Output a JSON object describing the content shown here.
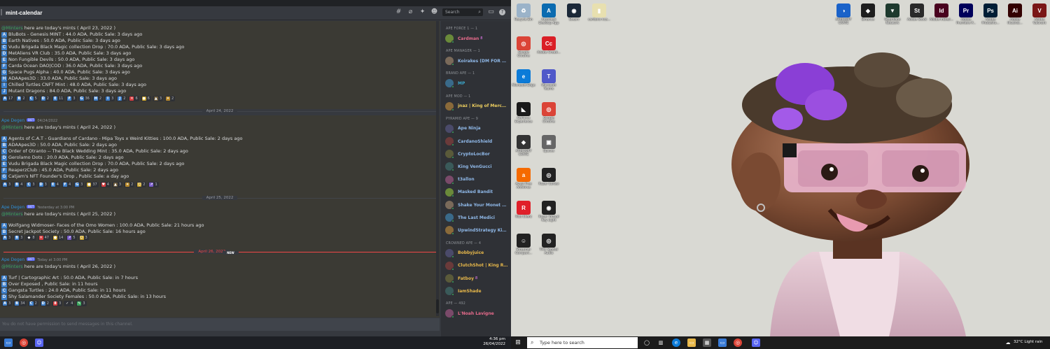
{
  "channel": {
    "title": "mint-calendar",
    "search_placeholder": "Search"
  },
  "messages": [
    {
      "greeting_mention": "@Minters",
      "greeting_text": " here are today's mints ( April 23, 2022 )",
      "items": [
        {
          "letter": "A",
          "text": "BluBots - Genesis MINT : 44.0 ADA, Public Sale: 3 days ago"
        },
        {
          "letter": "B",
          "text": "Earth Natives : 50.0 ADA, Public Sale: 3 days ago"
        },
        {
          "letter": "C",
          "text": "Vudu Brigada Black Magic collection Drop : 70.0 ADA, Public Sale: 3 days ago"
        },
        {
          "letter": "D",
          "text": "MetAliens VR Club : 35.0 ADA, Public Sale: 3 days ago"
        },
        {
          "letter": "E",
          "text": "Non Fungible Devils : 50.0 ADA, Public Sale: 3 days ago"
        },
        {
          "letter": "F",
          "text": "Carda Ocean DAO|COD : 36.0 ADA, Public Sale: 3 days ago"
        },
        {
          "letter": "G",
          "text": "Space Pugs Alpha : 40.0 ADA, Public Sale: 3 days ago"
        },
        {
          "letter": "H",
          "text": "ADAApes3D : 33.0 ADA, Public Sale: 3 days ago"
        },
        {
          "letter": "I",
          "text": "Chilled Turtles CNFT Mint : 48.0 ADA, Public Sale: 3 days ago"
        },
        {
          "letter": "J",
          "text": "Mutant Dragons : 84.0 ADA, Public Sale: 3 days ago"
        }
      ],
      "reactions": [
        {
          "icon": "A",
          "color": "#3c7ec9",
          "count": "17"
        },
        {
          "icon": "B",
          "color": "#3c7ec9",
          "count": "2"
        },
        {
          "icon": "C",
          "color": "#3c7ec9",
          "count": "5"
        },
        {
          "icon": "D",
          "color": "#3c7ec9",
          "count": "2"
        },
        {
          "icon": "E",
          "color": "#3c7ec9",
          "count": "11"
        },
        {
          "icon": "F",
          "color": "#3c7ec9",
          "count": "3"
        },
        {
          "icon": "G",
          "color": "#3c7ec9",
          "count": "36"
        },
        {
          "icon": "H",
          "color": "#3c7ec9",
          "count": "2"
        },
        {
          "icon": "I",
          "color": "#3c7ec9",
          "count": "3"
        },
        {
          "icon": "J",
          "color": "#3c7ec9",
          "count": "2"
        },
        {
          "icon": "✕",
          "color": "#d83c3e",
          "count": "6"
        },
        {
          "icon": "●",
          "color": "#c9a227",
          "count": "6"
        },
        {
          "icon": "▲",
          "color": "#6b5a3a",
          "count": "3"
        },
        {
          "icon": "✦",
          "color": "#b8892a",
          "count": "2"
        }
      ]
    },
    {
      "date_divider": "April 24, 2022",
      "author": "Ape Degen",
      "bot_tag": "BOT",
      "timestamp": "04/24/2022",
      "greeting_mention": "@Minters",
      "greeting_text": " here are today's mints ( April 24, 2022 )",
      "items": [
        {
          "letter": "A",
          "text": "Agents of C.A.T - Guardians of Cardano - Mipa Toys x Weird Kitties : 100.0 ADA, Public Sale: 2 days ago"
        },
        {
          "letter": "B",
          "text": "ADAApes3D : 50.0 ADA, Public Sale: 2 days ago"
        },
        {
          "letter": "C",
          "text": "Order of Otranto -- The Black Wedding Mint : 35.0 ADA, Public Sale: 2 days ago"
        },
        {
          "letter": "D",
          "text": "Gerolamo Dots : 20.0 ADA, Public Sale: 2 days ago"
        },
        {
          "letter": "E",
          "text": "Vudu Brigada Black Magic collection Drop : 70.0 ADA, Public Sale: 2 days ago"
        },
        {
          "letter": "F",
          "text": "ReaperzClub : 45.0 ADA, Public Sale: 2 days ago"
        },
        {
          "letter": "G",
          "text": "Catjam's NFT Founder's Drop , Public Sale: a day ago"
        }
      ],
      "reactions": [
        {
          "icon": "A",
          "color": "#3c7ec9",
          "count": "3"
        },
        {
          "icon": "B",
          "color": "#3c7ec9",
          "count": "4"
        },
        {
          "icon": "C",
          "color": "#3c7ec9",
          "count": "3"
        },
        {
          "icon": "D",
          "color": "#3c7ec9",
          "count": "3"
        },
        {
          "icon": "E",
          "color": "#3c7ec9",
          "count": "4"
        },
        {
          "icon": "F",
          "color": "#3c7ec9",
          "count": "4"
        },
        {
          "icon": "G",
          "color": "#3c7ec9",
          "count": "3"
        },
        {
          "icon": "●",
          "color": "#c9a227",
          "count": "37"
        },
        {
          "icon": "♥",
          "color": "#d83c3e",
          "count": "4"
        },
        {
          "icon": "▲",
          "color": "#6b5a3a",
          "count": "3"
        },
        {
          "icon": "✦",
          "color": "#b8892a",
          "count": "2"
        },
        {
          "icon": "☺",
          "color": "#c9a227",
          "count": "2"
        },
        {
          "icon": "↗",
          "color": "#7a5cc9",
          "count": "1"
        }
      ]
    },
    {
      "date_divider": "April 25, 2022",
      "author": "Ape Degen",
      "bot_tag": "BOT",
      "timestamp": "Yesterday at 3:00 PM",
      "greeting_mention": "@Minters",
      "greeting_text": " here are today's mints ( April 25, 2022 )",
      "items": [
        {
          "letter": "A",
          "text": "Wolfgang Widmoser- Faces of the Omo Women : 100.0 ADA, Public Sale: 21 hours ago"
        },
        {
          "letter": "B",
          "text": "Secret Jackpot Society : 50.0 ADA, Public Sale: 16 hours ago"
        }
      ],
      "reactions": [
        {
          "icon": "A",
          "color": "#3c7ec9",
          "count": "3"
        },
        {
          "icon": "B",
          "color": "#3c7ec9",
          "count": "3"
        },
        {
          "icon": "◆",
          "color": "#2f3136",
          "count": "8"
        },
        {
          "icon": "✕",
          "color": "#d83c3e",
          "count": "47"
        },
        {
          "icon": "●",
          "color": "#c9a227",
          "count": "14"
        },
        {
          "icon": "↗",
          "color": "#7a5cc9",
          "count": "5"
        },
        {
          "icon": "☺",
          "color": "#c9a227",
          "count": "3"
        }
      ]
    },
    {
      "date_divider": "April 26, 2022",
      "new_badge": "NEW",
      "author": "Ape Degen",
      "bot_tag": "BOT",
      "timestamp": "Today at 3:00 PM",
      "greeting_mention": "@Minters",
      "greeting_text": " here are today's mints ( April 26, 2022 )",
      "items": [
        {
          "letter": "A",
          "text": "Turf | Cartographic Art : 50.0 ADA, Public Sale: in 7 hours"
        },
        {
          "letter": "B",
          "text": "Over Exposed , Public Sale: in 11 hours"
        },
        {
          "letter": "C",
          "text": "Gangsta Turtles : 24.0 ADA, Public Sale: in 11 hours"
        },
        {
          "letter": "D",
          "text": "Shy Salamander Society Females : 50.0 ADA, Public Sale: in 13 hours"
        }
      ],
      "reactions": [
        {
          "icon": "A",
          "color": "#3c7ec9",
          "count": "3"
        },
        {
          "icon": "B",
          "color": "#3c7ec9",
          "count": "34"
        },
        {
          "icon": "C",
          "color": "#3c7ec9",
          "count": "2"
        },
        {
          "icon": "D",
          "color": "#3c7ec9",
          "count": "2"
        },
        {
          "icon": "8",
          "color": "#d83c3e",
          "count": "3"
        },
        {
          "icon": "✓",
          "color": "#2f3136",
          "count": "4"
        },
        {
          "icon": "✎",
          "color": "#3ba55d",
          "count": "3"
        }
      ]
    }
  ],
  "chat_input_placeholder": "You do not have permission to send messages in this channel.",
  "members": [
    {
      "role": "APE FORCE 1 — 1",
      "users": [
        {
          "name": "Cardman",
          "color": "#e86b8c",
          "badge": "8"
        }
      ]
    },
    {
      "role": "APE MANAGER — 1",
      "users": [
        {
          "name": "Koirakes (DM FOR CO...",
          "color": "#8fb8e8"
        }
      ]
    },
    {
      "role": "BRAND APE — 1",
      "users": [
        {
          "name": "MP",
          "color": "#3ba5c9"
        }
      ]
    },
    {
      "role": "APE MOD — 1",
      "users": [
        {
          "name": "jnaz | King of Merchants",
          "color": "#f0d060"
        }
      ]
    },
    {
      "role": "PYRAMID APE — 9",
      "users": [
        {
          "name": "Ape Ninja",
          "color": "#8fb8e8"
        },
        {
          "name": "CardanoShield",
          "color": "#8fb8e8"
        },
        {
          "name": "CryptoLocBor",
          "color": "#8fb8e8"
        },
        {
          "name": "King VenGucci",
          "color": "#8fb8e8"
        },
        {
          "name": "t3allon",
          "color": "#8fb8e8"
        },
        {
          "name": "Masked Bandit",
          "color": "#8fb8e8"
        },
        {
          "name": "Shake Your Monet Ma...",
          "color": "#8fb8e8"
        },
        {
          "name": "The Last Medici",
          "color": "#8fb8e8"
        },
        {
          "name": "UpwindStrategy King ...",
          "color": "#8fb8e8"
        }
      ]
    },
    {
      "role": "CROWNED APE — 4",
      "users": [
        {
          "name": "Bobbyjuice",
          "color": "#e8b84a"
        },
        {
          "name": "ClutchShot | King Rich",
          "color": "#e8b84a"
        },
        {
          "name": "Fatboy",
          "color": "#e8b84a",
          "badge": "8"
        },
        {
          "name": "IamShade",
          "color": "#e8b84a"
        }
      ]
    },
    {
      "role": "APE — 492",
      "users": [
        {
          "name": "L'Noah Lavigne",
          "color": "#e86b8c"
        }
      ]
    }
  ],
  "desktop_icons": [
    {
      "label": "Recycle Bin",
      "color": "#9bb3c9",
      "glyph": "♻"
    },
    {
      "label": "Autodesk Desktop App",
      "color": "#0b6bb0",
      "glyph": "A"
    },
    {
      "label": "Steam",
      "color": "#1b2838",
      "glyph": "◉"
    },
    {
      "label": "cardano nca...",
      "color": "#e8e0b0",
      "glyph": "▮"
    },
    {
      "label": "Google Chrome",
      "color": "#db4437",
      "glyph": "◎"
    },
    {
      "label": "Adobe Creati...",
      "color": "#da1f26",
      "glyph": "Cc"
    },
    {
      "label": "Microsoft Edge",
      "color": "#0c7bd8",
      "glyph": "e"
    },
    {
      "label": "Microsoft Teams",
      "color": "#5059c9",
      "glyph": "T"
    },
    {
      "label": "GeForce Experience",
      "color": "#1a1a1a",
      "glyph": "◣"
    },
    {
      "label": "Google Chrome",
      "color": "#db4437",
      "glyph": "◎"
    },
    {
      "label": "ARMOURY CRATE",
      "color": "#333333",
      "glyph": "◆"
    },
    {
      "label": "Spaces",
      "color": "#666666",
      "glyph": "▣"
    },
    {
      "label": "Avast Free Antivirus",
      "color": "#f56a00",
      "glyph": "a"
    },
    {
      "label": "Razer Cortex",
      "color": "#222222",
      "glyph": "◎"
    },
    {
      "label": "Riot Client",
      "color": "#e0202a",
      "glyph": "R"
    },
    {
      "label": "Razer Virtual Key Light",
      "color": "#222222",
      "glyph": "◉"
    },
    {
      "label": "Streamer Compani...",
      "color": "#222222",
      "glyph": "☺"
    },
    {
      "label": "THX Spatial Audio",
      "color": "#222222",
      "glyph": "◎"
    }
  ],
  "desktop_top_right_icons": [
    {
      "label": "ARMOURY CRATE",
      "color": "#1a62c9",
      "glyph": "◑"
    },
    {
      "label": "Binance",
      "color": "#1e1e1e",
      "glyph": "◆"
    },
    {
      "label": "Guardians Network",
      "color": "#1e3a2e",
      "glyph": "▼"
    },
    {
      "label": "Adobe Stock",
      "color": "#2a2a2a",
      "glyph": "St"
    },
    {
      "label": "Adobe InDesi...",
      "color": "#49021f",
      "glyph": "Id"
    },
    {
      "label": "Adobe Premiere P...",
      "color": "#00005b",
      "glyph": "Pr"
    },
    {
      "label": "Adobe Photosho...",
      "color": "#001e36",
      "glyph": "Ps"
    },
    {
      "label": "Adobe Illustrat...",
      "color": "#330000",
      "glyph": "Ai"
    },
    {
      "label": "Adobe Valorant",
      "color": "#7a1616",
      "glyph": "V"
    }
  ],
  "taskbar_left": {
    "time": "4:36 pm",
    "date": "26/04/2022"
  },
  "taskbar_right": {
    "search_placeholder": "Type here to search",
    "weather": "32°C  Light rain"
  }
}
